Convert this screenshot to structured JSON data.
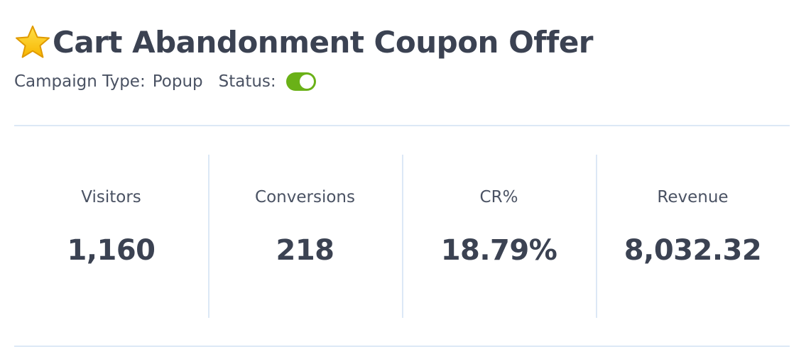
{
  "campaign": {
    "star_icon": "star-icon",
    "title": "Cart Abandonment Coupon Offer",
    "type_label": "Campaign Type:",
    "type_value": "Popup",
    "status_label": "Status:",
    "status_on": true,
    "toggle_color": "#6ab117"
  },
  "stats": [
    {
      "label": "Visitors",
      "value": "1,160"
    },
    {
      "label": "Conversions",
      "value": "218"
    },
    {
      "label": "CR%",
      "value": "18.79%"
    },
    {
      "label": "Revenue",
      "value": "8,032.32"
    }
  ]
}
